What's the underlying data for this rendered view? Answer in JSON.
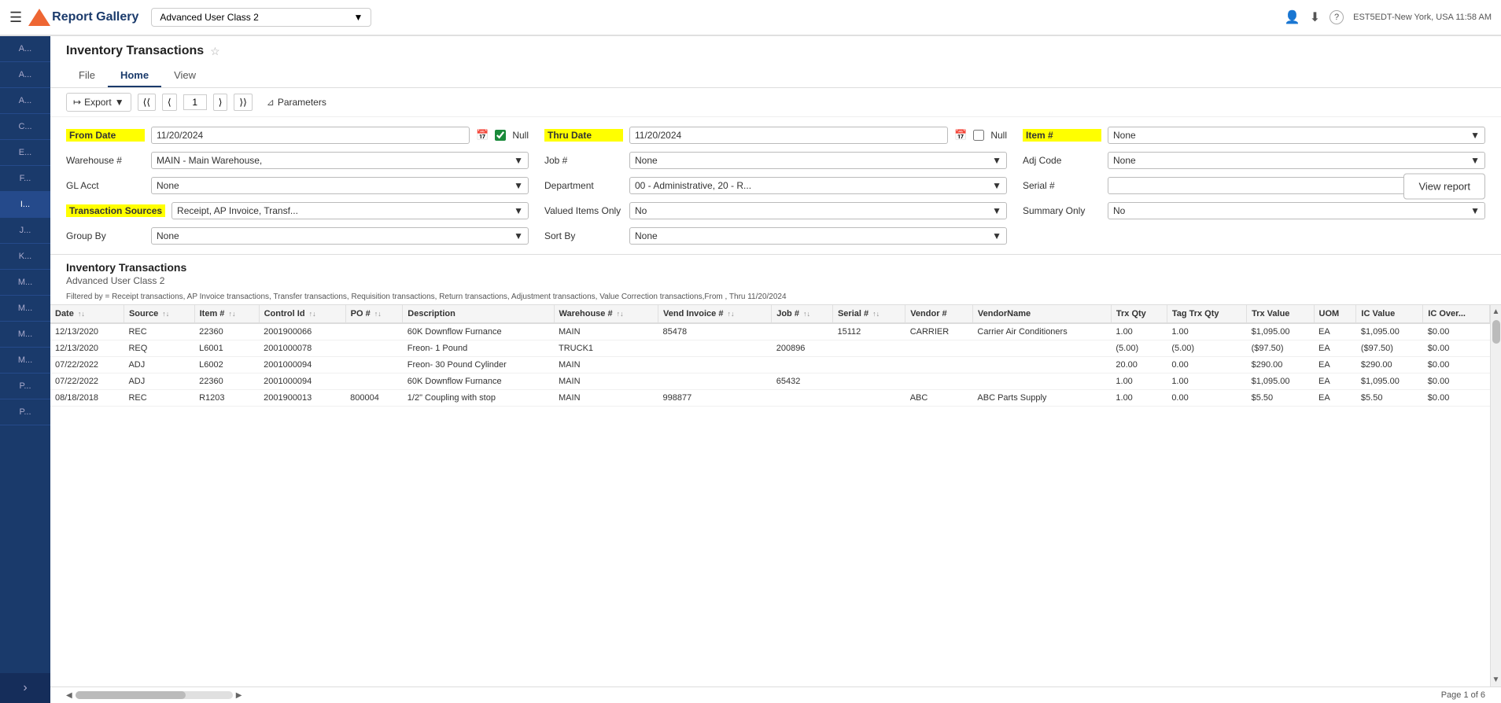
{
  "topNav": {
    "hamburger": "☰",
    "logoText": "Report Gallery",
    "appDropdown": "Advanced User Class 2",
    "userIcon": "👤",
    "downloadIcon": "⬇",
    "helpIcon": "?",
    "timeInfo": "EST5EDT-New York, USA 11:58 AM"
  },
  "sidebar": {
    "items": [
      {
        "label": "A...",
        "active": false
      },
      {
        "label": "A...",
        "active": false
      },
      {
        "label": "A...",
        "active": false
      },
      {
        "label": "C...",
        "active": false
      },
      {
        "label": "E...",
        "active": false
      },
      {
        "label": "F...",
        "active": false
      },
      {
        "label": "I...",
        "active": true
      },
      {
        "label": "J...",
        "active": false
      },
      {
        "label": "K...",
        "active": false
      },
      {
        "label": "M...",
        "active": false
      },
      {
        "label": "M...",
        "active": false
      },
      {
        "label": "M...",
        "active": false
      },
      {
        "label": "M...",
        "active": false
      },
      {
        "label": "P...",
        "active": false
      },
      {
        "label": "P...",
        "active": false
      }
    ],
    "expandLabel": "›"
  },
  "report": {
    "title": "Inventory Transactions",
    "starIcon": "☆",
    "tabs": [
      {
        "label": "File",
        "active": false
      },
      {
        "label": "Home",
        "active": true
      },
      {
        "label": "View",
        "active": false
      }
    ],
    "toolbar": {
      "exportLabel": "Export",
      "navFirst": "⟨⟨",
      "navPrev": "⟨",
      "pageNum": "1",
      "navNext": "⟩",
      "navLast": "⟩⟩",
      "filterIcon": "⊿",
      "parametersLabel": "Parameters"
    },
    "viewReportBtn": "View report",
    "params": {
      "fromDate": {
        "label": "From Date",
        "highlighted": true,
        "value": "11/20/2024",
        "nullChecked": true,
        "nullLabel": "Null"
      },
      "thruDate": {
        "label": "Thru Date",
        "highlighted": true,
        "value": "11/20/2024",
        "nullChecked": false,
        "nullLabel": "Null"
      },
      "itemNum": {
        "label": "Item #",
        "highlighted": true,
        "value": "None"
      },
      "warehouseNum": {
        "label": "Warehouse #",
        "value": "MAIN - Main Warehouse,"
      },
      "jobNum": {
        "label": "Job #",
        "value": "None"
      },
      "adjCode": {
        "label": "Adj Code",
        "value": "None"
      },
      "glAcct": {
        "label": "GL Acct",
        "value": "None"
      },
      "department": {
        "label": "Department",
        "value": "00 - Administrative, 20 - R..."
      },
      "serialNum": {
        "label": "Serial #",
        "value": ""
      },
      "transactionSources": {
        "label": "Transaction Sources",
        "highlighted": true,
        "value": "Receipt, AP Invoice, Transf..."
      },
      "valuedItemsOnly": {
        "label": "Valued Items Only",
        "value": "No"
      },
      "summaryOnly": {
        "label": "Summary Only",
        "value": "No"
      },
      "groupBy": {
        "label": "Group By",
        "value": "None"
      },
      "sortBy": {
        "label": "Sort By",
        "value": "None"
      }
    },
    "resultsTitle": "Inventory  Transactions",
    "resultsSubtitle": "Advanced User Class 2",
    "filterText": "Filtered by = Receipt transactions, AP Invoice transactions, Transfer transactions, Requisition transactions, Return transactions, Adjustment transactions, Value Correction transactions,From ,  Thru 11/20/2024",
    "tableColumns": [
      {
        "label": "Date",
        "sortable": true
      },
      {
        "label": "Source",
        "sortable": true
      },
      {
        "label": "Item #",
        "sortable": true
      },
      {
        "label": "Control Id",
        "sortable": true
      },
      {
        "label": "PO #",
        "sortable": true
      },
      {
        "label": "Description",
        "sortable": false
      },
      {
        "label": "Warehouse #",
        "sortable": true
      },
      {
        "label": "Vend Invoice #",
        "sortable": true
      },
      {
        "label": "Job #",
        "sortable": true
      },
      {
        "label": "Serial #",
        "sortable": true
      },
      {
        "label": "Vendor #",
        "sortable": false
      },
      {
        "label": "VendorName",
        "sortable": false
      },
      {
        "label": "Trx Qty",
        "sortable": false
      },
      {
        "label": "Tag Trx Qty",
        "sortable": false
      },
      {
        "label": "Trx Value",
        "sortable": false
      },
      {
        "label": "UOM",
        "sortable": false
      },
      {
        "label": "IC Value",
        "sortable": false
      },
      {
        "label": "IC Over...",
        "sortable": false
      }
    ],
    "tableRows": [
      {
        "date": "12/13/2020",
        "source": "REC",
        "itemNum": "22360",
        "controlId": "2001900066",
        "poNum": "",
        "description": "60K Downflow Furnance",
        "warehouseNum": "MAIN",
        "vendInvoice": "85478",
        "jobNum": "",
        "serialNum": "15112",
        "vendorNum": "CARRIER",
        "vendorName": "Carrier Air Conditioners",
        "trxQty": "1.00",
        "tagTrxQty": "1.00",
        "trxValue": "$1,095.00",
        "uom": "EA",
        "icValue": "$1,095.00",
        "icOver": "$0.00"
      },
      {
        "date": "12/13/2020",
        "source": "REQ",
        "itemNum": "L6001",
        "controlId": "2001000078",
        "poNum": "",
        "description": "Freon- 1 Pound",
        "warehouseNum": "TRUCK1",
        "vendInvoice": "",
        "jobNum": "200896",
        "serialNum": "",
        "vendorNum": "",
        "vendorName": "",
        "trxQty": "(5.00)",
        "tagTrxQty": "(5.00)",
        "trxValue": "($97.50)",
        "uom": "EA",
        "icValue": "($97.50)",
        "icOver": "$0.00"
      },
      {
        "date": "07/22/2022",
        "source": "ADJ",
        "itemNum": "L6002",
        "controlId": "2001000094",
        "poNum": "",
        "description": "Freon- 30 Pound Cylinder",
        "warehouseNum": "MAIN",
        "vendInvoice": "",
        "jobNum": "",
        "serialNum": "",
        "vendorNum": "",
        "vendorName": "",
        "trxQty": "20.00",
        "tagTrxQty": "0.00",
        "trxValue": "$290.00",
        "uom": "EA",
        "icValue": "$290.00",
        "icOver": "$0.00"
      },
      {
        "date": "07/22/2022",
        "source": "ADJ",
        "itemNum": "22360",
        "controlId": "2001000094",
        "poNum": "",
        "description": "60K Downflow Furnance",
        "warehouseNum": "MAIN",
        "vendInvoice": "",
        "jobNum": "65432",
        "serialNum": "",
        "vendorNum": "",
        "vendorName": "",
        "trxQty": "1.00",
        "tagTrxQty": "1.00",
        "trxValue": "$1,095.00",
        "uom": "EA",
        "icValue": "$1,095.00",
        "icOver": "$0.00"
      },
      {
        "date": "08/18/2018",
        "source": "REC",
        "itemNum": "R1203",
        "controlId": "2001900013",
        "poNum": "800004",
        "description": "1/2\" Coupling with stop",
        "warehouseNum": "MAIN",
        "vendInvoice": "998877",
        "jobNum": "",
        "serialNum": "",
        "vendorNum": "ABC",
        "vendorName": "ABC Parts Supply",
        "trxQty": "1.00",
        "tagTrxQty": "0.00",
        "trxValue": "$5.50",
        "uom": "EA",
        "icValue": "$5.50",
        "icOver": "$0.00"
      }
    ],
    "pageInfo": "Page 1 of 6"
  }
}
